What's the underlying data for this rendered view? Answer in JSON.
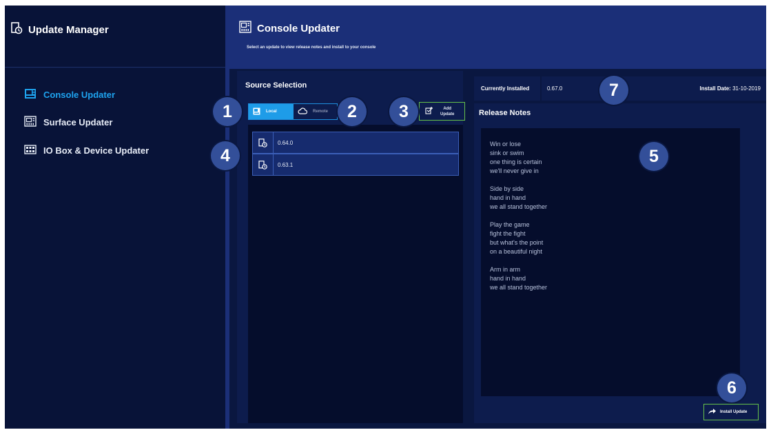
{
  "sidebar": {
    "app_title": "Update Manager",
    "items": [
      {
        "label": "Console Updater",
        "icon": "console-icon",
        "active": true
      },
      {
        "label": "Surface Updater",
        "icon": "surface-icon",
        "active": false
      },
      {
        "label": "IO Box & Device Updater",
        "icon": "io-box-icon",
        "active": false
      }
    ]
  },
  "header": {
    "title": "Console Updater",
    "subtitle": "Select an update to view release notes and install to your console"
  },
  "source": {
    "title": "Source Selection",
    "local_label": "Local",
    "remote_label": "Remote",
    "add_label_line1": "Add",
    "add_label_line2": "Update",
    "versions": [
      {
        "version": "0.64.0",
        "icon": "update-file-icon"
      },
      {
        "version": "0.63.1",
        "icon": "update-file-icon"
      }
    ]
  },
  "installed": {
    "label": "Currently Installed",
    "version": "0.67.0",
    "date_label": "Install Date:",
    "date": "31-10-2019"
  },
  "release_notes": {
    "title": "Release Notes",
    "text": "Win or lose\nsink or swim\none thing is certain\nwe'll never give in\n\nSide by side\nhand in hand\nwe all stand together\n\nPlay the game\nfight the fight\nbut what's the point\non a beautiful night\n\nArm in arm\nhand in hand\nwe all stand together"
  },
  "install_button": {
    "label": "Install Update"
  },
  "callouts": [
    "1",
    "2",
    "3",
    "4",
    "5",
    "6",
    "7"
  ],
  "colors": {
    "background": "#0a1740",
    "header_accent": "#1b2f78",
    "active_blue": "#1ea4f0",
    "button_green": "#67c24a",
    "callout": "#334f99"
  }
}
